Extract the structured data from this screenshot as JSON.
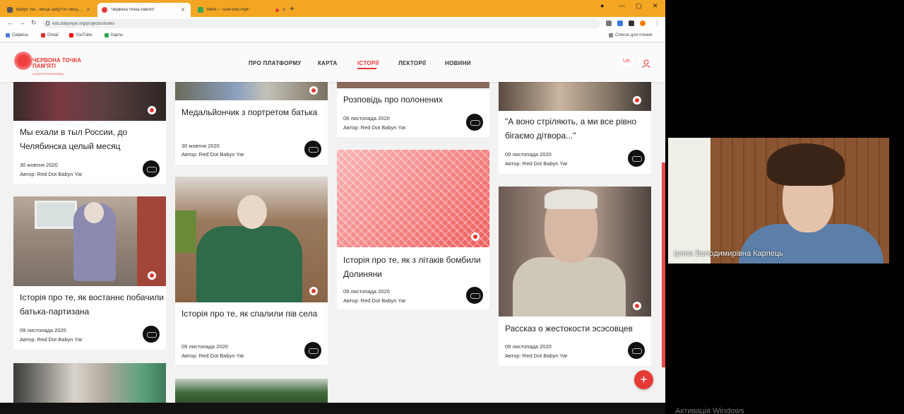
{
  "browser": {
    "tabs": [
      {
        "label": "Babyn Yar - місце забуття і місц…",
        "active": false
      },
      {
        "label": "Червона точка пам'яті",
        "active": true
      },
      {
        "label": "Meet – \"uuw-wds-myk\"",
        "active": false
      }
    ],
    "url": "edu.babynyar.org/projects/stories",
    "bookmarks": [
      "Сервісы",
      "Gmail",
      "YouTube",
      "Карты"
    ],
    "reading_list": "Список для чтения"
  },
  "site": {
    "logo_line1": "ЧЕРВОНА ТОЧКА",
    "logo_line2": "ПАМ'ЯТІ",
    "logo_sub": "ОСВІТНЯ ПЛАТФОРМА",
    "nav": [
      "ПРО ПЛАТФОРМУ",
      "КАРТА",
      "ІСТОРІЇ",
      "ЛЕКТОРІЇ",
      "НОВИНИ"
    ],
    "active_nav": "ІСТОРІЇ",
    "lang": "UA"
  },
  "cards": [
    {
      "title": "Мы ехали в тыл России, до Челябинска целый месяц",
      "date": "30 жовтня 2020",
      "author": "Автор: Red Dot Babyn Yar"
    },
    {
      "title": "Медальйончик з портретом батька",
      "date": "30 жовтня 2020",
      "author": "Автор: Red Dot Babyn Yar"
    },
    {
      "title": "Розповідь про полонених",
      "date": "09 листопада 2020",
      "author": "Автор: Red Dot Babyn Yar"
    },
    {
      "title": "\"А воно стріляють, а ми все рівно бігаємо дітвора...\"",
      "date": "09 листопада 2020",
      "author": "Автор: Red Dot Babyn Yar"
    },
    {
      "title": "Історія про те, як востаннє побачили батька-партизана",
      "date": "09 листопада 2020",
      "author": "Автор: Red Dot Babyn Yar"
    },
    {
      "title": "Історія про те, як спалили пів села",
      "date": "09 листопада 2020",
      "author": "Автор: Red Dot Babyn Yar"
    },
    {
      "title": "Історія про те, як з літаків бомбили Долиняни",
      "date": "09 листопада 2020",
      "author": "Автор: Red Dot Babyn Yar"
    },
    {
      "title": "Рассказ о жестокости эсэсовцев",
      "date": "09 листопада 2020",
      "author": "Автор: Red Dot Babyn Yar"
    }
  ],
  "fab_label": "+",
  "video": {
    "participant_name": "Ірина Володимирівна Карпець"
  },
  "os_watermark": "Активація Windows",
  "colors": {
    "accent": "#e53935",
    "tabbar": "#f3a623"
  }
}
